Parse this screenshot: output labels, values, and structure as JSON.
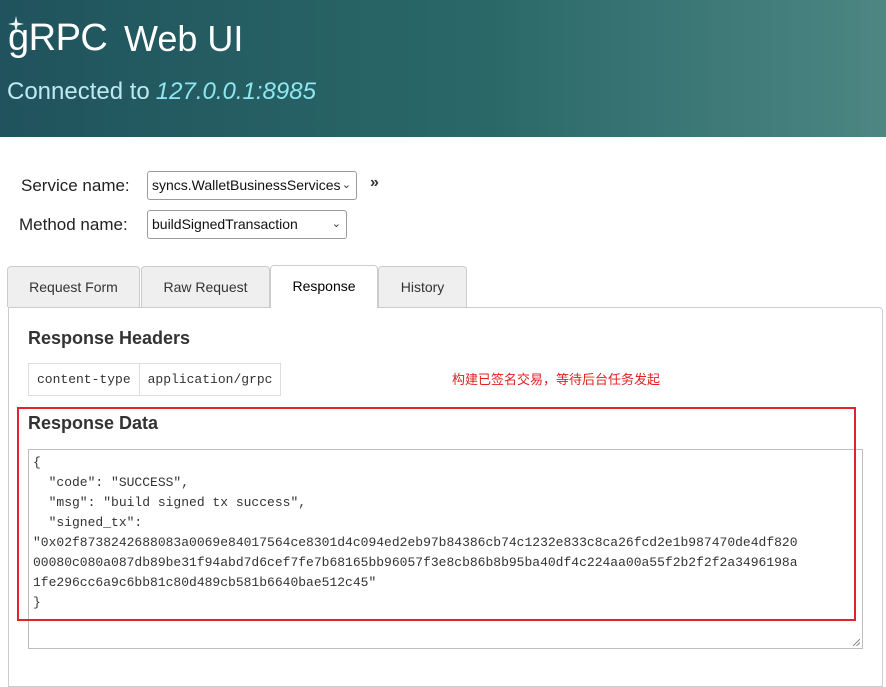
{
  "header": {
    "logo_text": "gRPC",
    "title": "Web UI",
    "connected_label": "Connected to",
    "address": "127.0.0.1:8985"
  },
  "form": {
    "service_label": "Service name:",
    "service_value": "syncs.WalletBusinessServices",
    "method_label": "Method name:",
    "method_value": "buildSignedTransaction",
    "invoke_symbol": "»"
  },
  "tabs": [
    {
      "label": "Request Form"
    },
    {
      "label": "Raw Request"
    },
    {
      "label": "Response",
      "active": true
    },
    {
      "label": "History"
    }
  ],
  "response": {
    "headers_title": "Response Headers",
    "headers": [
      {
        "key": "content-type",
        "value": "application/grpc"
      }
    ],
    "annotation": "构建已签名交易，等待后台任务发起",
    "data_title": "Response Data",
    "data_lines": [
      "{",
      "  \"code\": \"SUCCESS\",",
      "  \"msg\": \"build signed tx success\",",
      "  \"signed_tx\":",
      "\"0x02f8738242688083a0069e84017564ce8301d4c094ed2eb97b84386cb74c1232e833c8ca26fcd2e1b987470de4df820",
      "00080c080a087db89be31f94abd7d6cef7fe7b68165bb96057f3e8cb86b8b95ba40df4c224aa00a55f2b2f2f2a3496198a",
      "1fe296cc6a9c6bb81c80d489cb581b6640bae512c45\"",
      "}"
    ]
  },
  "colors": {
    "header_start": "#20535d",
    "header_end": "#4d8683",
    "address": "#8ee6ef",
    "annotation": "#e02020",
    "highlight_box": "#e0242b"
  }
}
